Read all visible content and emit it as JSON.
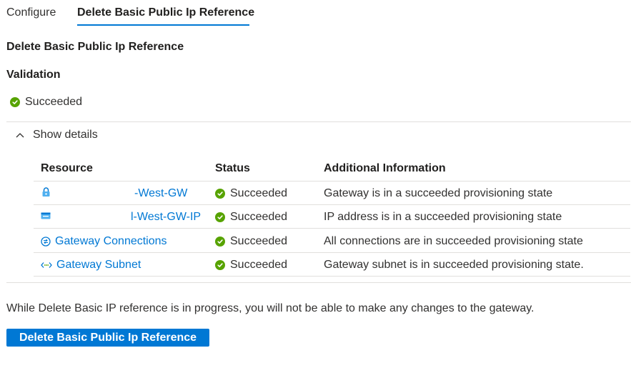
{
  "tabs": [
    {
      "label": "Configure",
      "active": false
    },
    {
      "label": "Delete Basic Public Ip Reference",
      "active": true
    }
  ],
  "section_title": "Delete Basic Public Ip Reference",
  "validation": {
    "heading": "Validation",
    "status": "Succeeded",
    "status_color": "#57a300"
  },
  "details_toggle": {
    "label": "Show details",
    "icon": "chevron-up-icon"
  },
  "table": {
    "headers": [
      "Resource",
      "Status",
      "Additional Information"
    ],
    "rows": [
      {
        "resource": "-West-GW",
        "resource_icon": "gateway-lock-icon",
        "status": "Succeeded",
        "info": "Gateway is in a succeeded provisioning state"
      },
      {
        "resource": "l-West-GW-IP",
        "resource_icon": "public-ip-icon",
        "status": "Succeeded",
        "info": "IP address is in a succeeded provisioning state"
      },
      {
        "resource": "Gateway Connections",
        "resource_icon": "connections-icon",
        "status": "Succeeded",
        "info": "All connections are in succeeded provisioning state"
      },
      {
        "resource": "Gateway Subnet",
        "resource_icon": "subnet-icon",
        "status": "Succeeded",
        "info": "Gateway subnet is in succeeded provisioning state."
      }
    ]
  },
  "notice": "While Delete Basic IP reference is in progress, you will not be able to make any changes to the gateway.",
  "action_button": {
    "label": "Delete Basic Public Ip Reference"
  },
  "colors": {
    "accent": "#0078d4",
    "success": "#57a300",
    "divider": "#e1dfdd"
  }
}
